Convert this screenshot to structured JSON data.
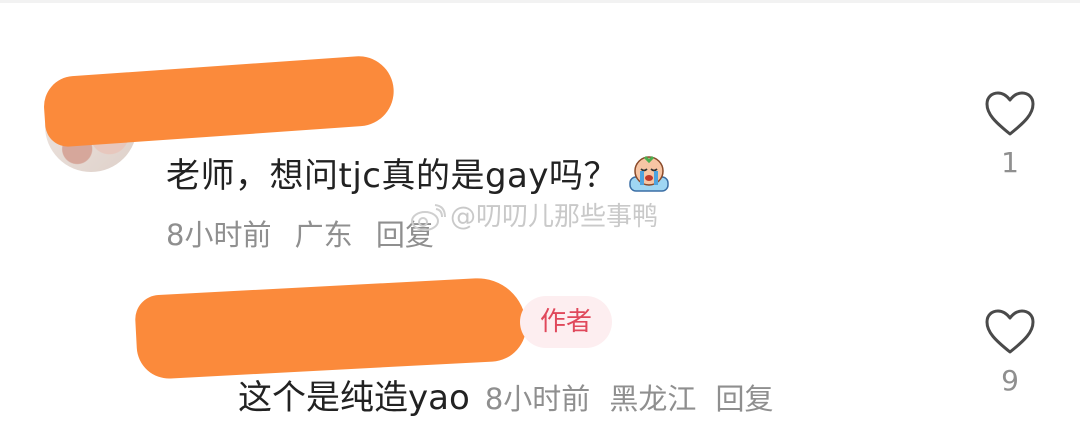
{
  "comments": [
    {
      "text": "老师，想问tjc真的是gay吗？",
      "time": "8小时前",
      "location": "广东",
      "reply_label": "回复",
      "like_count": "1"
    },
    {
      "badge": "作者",
      "text": "这个是纯造yao",
      "time": "8小时前",
      "location": "黑龙江",
      "reply_label": "回复",
      "like_count": "9"
    }
  ],
  "watermark": "@叨叨儿那些事鸭",
  "colors": {
    "redaction": "#fb8a3b",
    "badge_text": "#e0485b",
    "badge_bg": "#fdeef0",
    "meta": "#8f8f8f"
  },
  "icons": [
    "heart-outline-icon",
    "crying-emoji-icon",
    "weibo-watermark-icon"
  ]
}
